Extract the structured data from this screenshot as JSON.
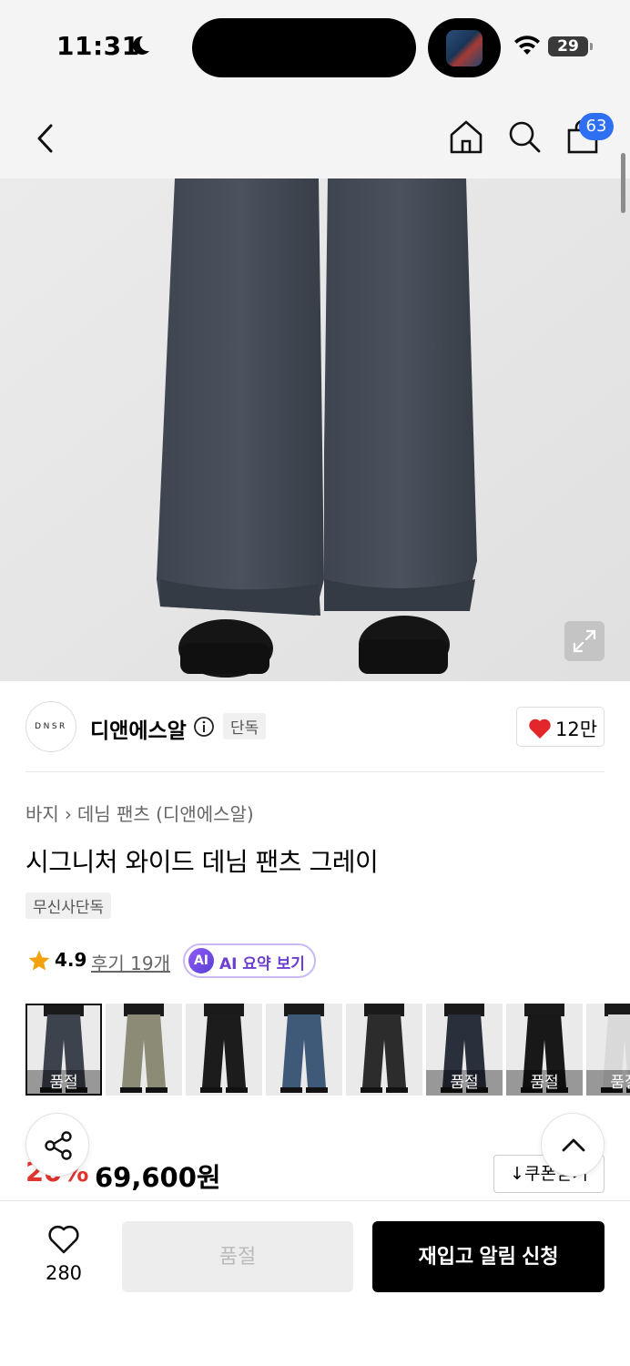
{
  "status_bar": {
    "time": "11:31",
    "battery": "29"
  },
  "nav": {
    "back_icon": "chevron-left-icon",
    "home_icon": "home-icon",
    "search_icon": "search-icon",
    "cart_icon": "shopping-bag-icon",
    "cart_count": "63"
  },
  "brand": {
    "logo_text": "DNSR",
    "name": "디앤에스알",
    "exclusive_badge": "단독",
    "like_count": "12만",
    "heart_color": "#e3262b"
  },
  "product": {
    "breadcrumb": [
      "바지",
      "데님 팬츠 (디앤에스알)"
    ],
    "title": "시그니처 와이드 데님 팬츠 그레이",
    "tag": "무신사단독",
    "rating": "4.9",
    "reviews": "후기 19개",
    "ai_icon_text": "AI",
    "ai_summary": "AI 요약 보기"
  },
  "thumbnails": [
    {
      "label": "품절",
      "tone": "#3d434c",
      "selected": true
    },
    {
      "label": "",
      "tone": "#8c8b76"
    },
    {
      "label": "",
      "tone": "#1c1c1c"
    },
    {
      "label": "",
      "tone": "#3f5a78"
    },
    {
      "label": "",
      "tone": "#2c2c2c"
    },
    {
      "label": "품절",
      "tone": "#2a2f3c"
    },
    {
      "label": "품절",
      "tone": "#181818"
    },
    {
      "label": "품절",
      "tone": "#d9d9d9"
    }
  ],
  "price": {
    "original_suffix": "원",
    "discount": "20%",
    "final": "69,600원",
    "coupon_label": "쿠폰받기",
    "accent_color": "#e0342d"
  },
  "bottom_bar": {
    "wish_count": "280",
    "soldout_label": "품절",
    "restock_label": "재입고 알림 신청"
  },
  "colors": {
    "badge_blue": "#2f6ff2",
    "ai_purple": "#6b3fd0"
  }
}
